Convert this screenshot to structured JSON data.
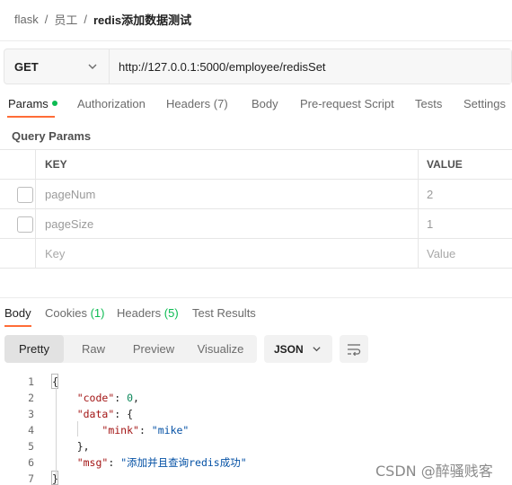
{
  "breadcrumb": {
    "items": [
      "flask",
      "员工",
      "redis添加数据测试"
    ],
    "separator": "/"
  },
  "request": {
    "method": "GET",
    "url": "http://127.0.0.1:5000/employee/redisSet"
  },
  "request_tabs": {
    "params": "Params",
    "authorization": "Authorization",
    "headers": "Headers",
    "headers_count": "(7)",
    "body": "Body",
    "pre_request": "Pre-request Script",
    "tests": "Tests",
    "settings": "Settings"
  },
  "query_params": {
    "label": "Query Params",
    "columns": [
      "KEY",
      "VALUE"
    ],
    "rows": [
      {
        "key": "pageNum",
        "value": "2"
      },
      {
        "key": "pageSize",
        "value": "1"
      }
    ],
    "placeholder": {
      "key": "Key",
      "value": "Value"
    }
  },
  "response_tabs": {
    "body": "Body",
    "cookies": "Cookies",
    "cookies_count": "(1)",
    "headers": "Headers",
    "headers_count": "(5)",
    "test_results": "Test Results"
  },
  "view_modes": [
    "Pretty",
    "Raw",
    "Preview",
    "Visualize"
  ],
  "format": "JSON",
  "code": {
    "line_numbers": [
      "1",
      "2",
      "3",
      "4",
      "5",
      "6",
      "7"
    ],
    "open_brace": "{",
    "close_brace": "}",
    "code_key": "\"code\"",
    "code_value": "0",
    "data_key": "\"data\"",
    "mink_key": "\"mink\"",
    "mink_value": "\"mike\"",
    "msg_key": "\"msg\"",
    "msg_value": "\"添加并且查询redis成功\""
  },
  "watermark": "CSDN @醉骚贱客",
  "colors": {
    "accent": "#ff6c37",
    "success": "#0cbb52"
  },
  "icons": {
    "method_dropdown": "chevron-down-icon",
    "format_dropdown": "chevron-down-icon",
    "wrap": "wrap-lines-icon"
  }
}
